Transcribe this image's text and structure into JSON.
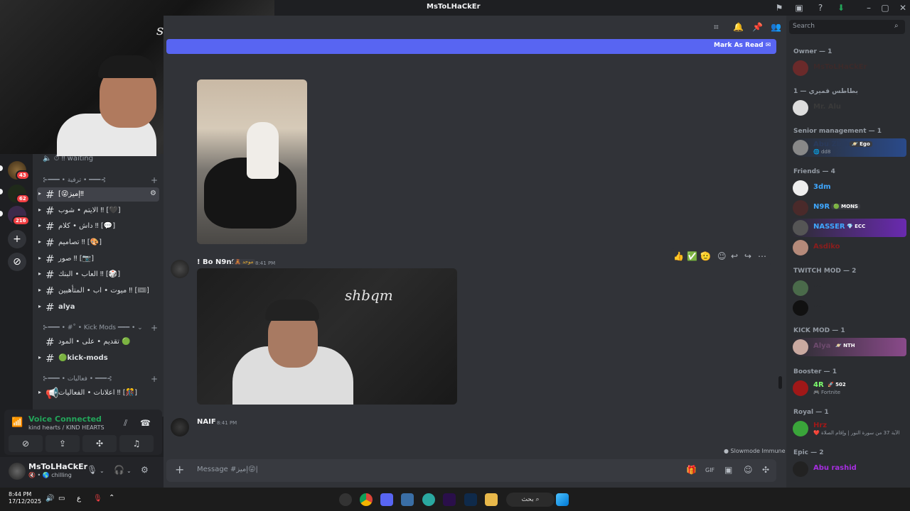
{
  "window": {
    "title": "MsToLHaCkEr"
  },
  "servers": {
    "badges": [
      "43",
      "62",
      "216"
    ]
  },
  "channels": {
    "voice_waiting": "⏱ ‼ waiting",
    "cat1": "⊱━━━ • ترفية • ━━━⊰",
    "items": [
      {
        "name": "[😜إميز‼"
      },
      {
        "name": "الايتم • شوب ‼ [🖤]"
      },
      {
        "name": "داش • كلام ‼ [💬]"
      },
      {
        "name": "تصاميم ‼ [🎨]"
      },
      {
        "name": "صور ‼ [📷]"
      },
      {
        "name": "العاب • البنك ‼ [🎲]"
      },
      {
        "name": "ميوت • اب • المتأهبين ‼ [🎟]"
      },
      {
        "name": "alya"
      }
    ],
    "cat2": "⊱━━━ • #˚ • Kick Mods ━━━ • ⌄",
    "items2": [
      {
        "name": "تقديم • على • المود 🟢"
      },
      {
        "name": "🟢kick-mods"
      }
    ],
    "cat3": "⊱━━━ • فعاليات • ━━━⊰",
    "items3": [
      {
        "name": "اعلانات • الفعاليات ‼ [🎊]"
      }
    ]
  },
  "voice": {
    "title": "Voice Connected",
    "sub": "kind hearts / KIND HEARTS"
  },
  "user": {
    "name": "MsToLHaCkEr",
    "status": "🔇 • 🌎 chilling"
  },
  "banner": {
    "label": "Mark As Read"
  },
  "messages": [
    {
      "author": "! Bo N9n9",
      "tag": "🧸 موحد",
      "time": "8:41 PM"
    },
    {
      "author": "NAIF",
      "time": "8:41 PM"
    }
  ],
  "webcam_sign": "shbqm",
  "slowmode": "Slowmode Immune",
  "composer": {
    "placeholder": "Message #إميز😜|"
  },
  "search": {
    "placeholder": "Search"
  },
  "members": {
    "groups": [
      {
        "label": "Owner — 1",
        "top": 0
      },
      {
        "label": "1 — بطاطس قميري",
        "top": 0
      },
      {
        "label": "Senior management — 1",
        "top": 0
      },
      {
        "label": "Friends — 4",
        "top": 0
      },
      {
        "label": "TWITCH MOD — 2",
        "top": 0
      },
      {
        "label": "KICK MOD — 1",
        "top": 0
      },
      {
        "label": "Booster — 1",
        "top": 0
      },
      {
        "label": "Royal — 1",
        "top": 0
      },
      {
        "label": "Epic — 2",
        "top": 0
      }
    ],
    "people": [
      {
        "name": "MsToLHaCkEr",
        "color": "#3c2a2a"
      },
      {
        "name": "Mr. Alu",
        "color": "#3a3a3a",
        "tag": ""
      },
      {
        "name": "Abu Zbrh",
        "color": "#2a3a5a",
        "tag": "🪐 Ego",
        "sub": "🌐 dd8"
      },
      {
        "name": "3dm",
        "color": "#3fa7ff"
      },
      {
        "name": "N9R",
        "color": "#3fa7ff",
        "tag": "🟢 MONS"
      },
      {
        "name": "NASSER",
        "color": "#3fa7ff",
        "tag": "💎 ECC"
      },
      {
        "name": "Asdiko",
        "color": "#8a1d1d"
      },
      {
        "name": "···",
        "color": "#2b2d31"
      },
      {
        "name": "···",
        "color": "#2b2d31"
      },
      {
        "name": "Alya",
        "color": "#6d4a6d",
        "tag": "🪐 NTH"
      },
      {
        "name": "4R",
        "color": "#7dff6e",
        "tag": "🚀 502",
        "sub": "🎮 Fortnite"
      },
      {
        "name": "Hrz",
        "color": "#a01818",
        "sub": "❤️ الآية 37 من سورة النور | وإقام الصلاة"
      },
      {
        "name": "Abu rashid",
        "color": "#a62ee0"
      }
    ]
  },
  "taskbar": {
    "time": "8:44 PM",
    "date": "17/12/2025",
    "search": "بحث ⌕",
    "lang": "ع"
  }
}
